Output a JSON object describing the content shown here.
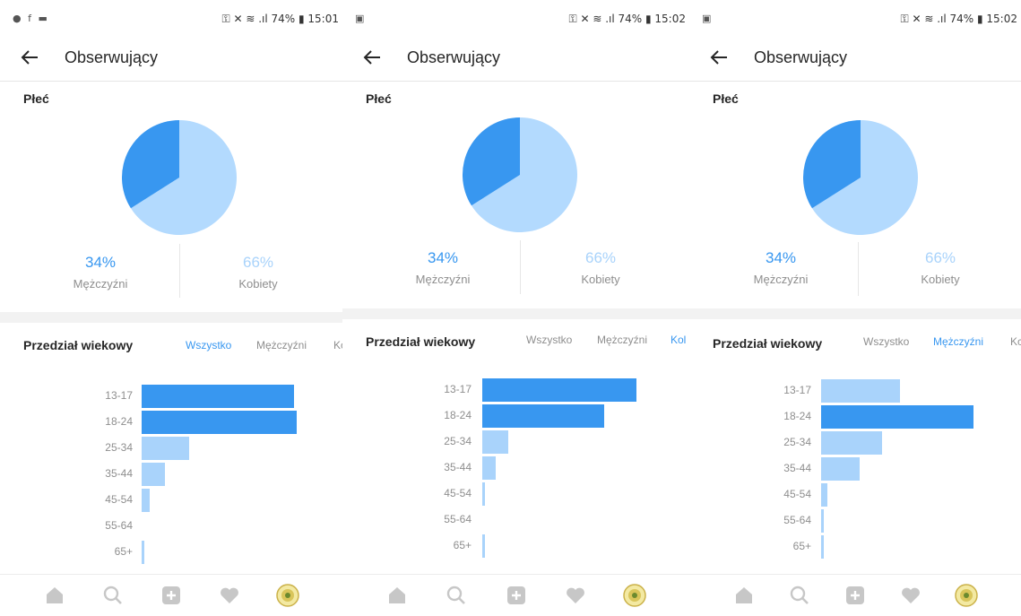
{
  "colors": {
    "men": "#3897f0",
    "women": "#a9d3fb",
    "men_fill": "#3897f0",
    "women_fill": "#b3dafe"
  },
  "panels": [
    {
      "status_left": "● f ▬",
      "status_right": "⚿ ✕ ≋ .ıl 74% ▮ 15:01",
      "title": "Obserwujący",
      "gender": {
        "title": "Płeć",
        "men_pct": "34%",
        "men_label": "Mężczyźni",
        "women_pct": "66%",
        "women_label": "Kobiety",
        "men_value": 34,
        "women_value": 66
      },
      "age": {
        "title": "Przedział wiekowy",
        "tabs": [
          "Wszystko",
          "Mężczyźni",
          "Kol"
        ],
        "active_tab": 0,
        "groups": [
          "13-17",
          "18-24",
          "25-34",
          "35-44",
          "45-54",
          "55-64",
          "65+"
        ],
        "values": [
          100,
          102,
          31,
          15,
          5,
          0,
          2
        ],
        "highlight": [
          true,
          true,
          false,
          false,
          false,
          false,
          false
        ]
      }
    },
    {
      "status_left": "▣",
      "status_right": "⚿ ✕ ≋ .ıl 74% ▮ 15:02",
      "title": "Obserwujący",
      "gender": {
        "title": "Płeć",
        "men_pct": "34%",
        "men_label": "Mężczyźni",
        "women_pct": "66%",
        "women_label": "Kobiety",
        "men_value": 34,
        "women_value": 66
      },
      "age": {
        "title": "Przedział wiekowy",
        "tabs": [
          "Wszystko",
          "Mężczyźni",
          "Kol"
        ],
        "active_tab": 2,
        "groups": [
          "13-17",
          "18-24",
          "25-34",
          "35-44",
          "45-54",
          "55-64",
          "65+"
        ],
        "values": [
          100,
          79,
          17,
          9,
          2,
          0,
          2
        ],
        "highlight": [
          true,
          true,
          false,
          false,
          false,
          false,
          false
        ]
      }
    },
    {
      "status_left": "▣",
      "status_right": "⚿ ✕ ≋ .ıl 74% ▮ 15:02",
      "title": "Obserwujący",
      "gender": {
        "title": "Płeć",
        "men_pct": "34%",
        "men_label": "Mężczyźni",
        "women_pct": "66%",
        "women_label": "Kobiety",
        "men_value": 34,
        "women_value": 66
      },
      "age": {
        "title": "Przedział wiekowy",
        "tabs": [
          "Wszystko",
          "Mężczyźni",
          "Kc"
        ],
        "active_tab": 1,
        "groups": [
          "13-17",
          "18-24",
          "25-34",
          "35-44",
          "45-54",
          "55-64",
          "65+"
        ],
        "values": [
          52,
          100,
          40,
          25,
          4,
          1,
          1
        ],
        "highlight": [
          false,
          true,
          false,
          false,
          false,
          false,
          false
        ]
      }
    }
  ],
  "nav_icons": [
    "home-icon",
    "search-icon",
    "add-icon",
    "heart-icon",
    "profile-avatar"
  ]
}
